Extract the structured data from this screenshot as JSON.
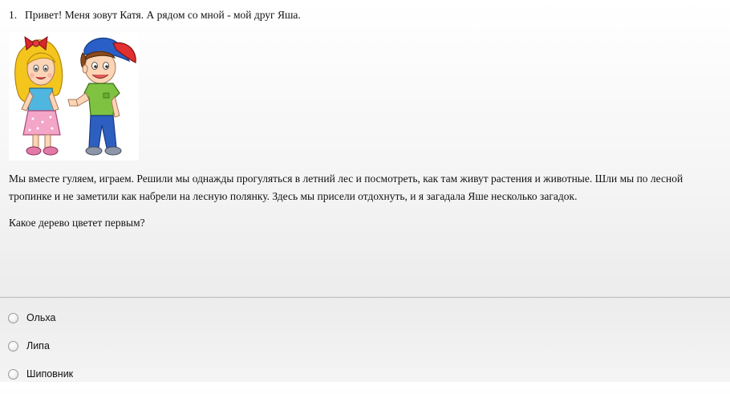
{
  "question": {
    "number": "1.",
    "title": "Привет! Меня зовут Катя. А рядом со мной - мой друг Яша.",
    "story": "Мы вместе гуляем, играем. Решили мы однажды прогуляться в летний лес и посмотреть, как там живут растения и животные. Шли мы по лесной тропинке и не заметили как набрели на лесную полянку. Здесь мы присели отдохнуть, и я загадала Яше несколько загадок.",
    "prompt": "Какое дерево цветет первым?"
  },
  "options": [
    {
      "label": "Ольха",
      "selected": false
    },
    {
      "label": "Липа",
      "selected": false
    },
    {
      "label": "Шиповник",
      "selected": false
    }
  ]
}
